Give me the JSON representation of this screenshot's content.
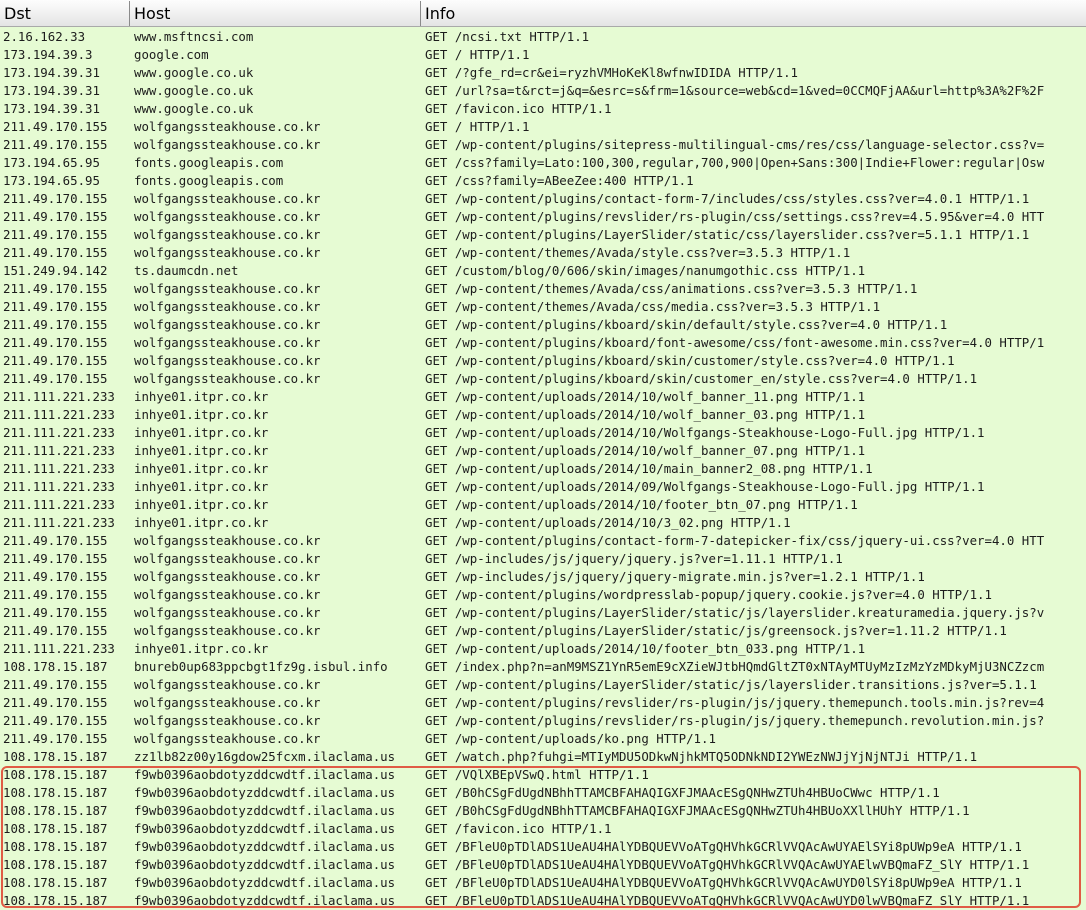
{
  "columns": {
    "dst": "Dst",
    "host": "Host",
    "info": "Info"
  },
  "colors": {
    "row_bg": "#e6fbd3",
    "highlight_border": "#e05b45"
  },
  "rows": [
    [
      "2.16.162.33",
      "www.msftncsi.com",
      "GET /ncsi.txt HTTP/1.1"
    ],
    [
      "173.194.39.3",
      "google.com",
      "GET / HTTP/1.1"
    ],
    [
      "173.194.39.31",
      "www.google.co.uk",
      "GET /?gfe_rd=cr&ei=ryzhVMHoKeKl8wfnwIDIDA HTTP/1.1"
    ],
    [
      "173.194.39.31",
      "www.google.co.uk",
      "GET /url?sa=t&rct=j&q=&esrc=s&frm=1&source=web&cd=1&ved=0CCMQFjAA&url=http%3A%2F%2F"
    ],
    [
      "173.194.39.31",
      "www.google.co.uk",
      "GET /favicon.ico HTTP/1.1"
    ],
    [
      "211.49.170.155",
      "wolfgangssteakhouse.co.kr",
      "GET / HTTP/1.1"
    ],
    [
      "211.49.170.155",
      "wolfgangssteakhouse.co.kr",
      "GET /wp-content/plugins/sitepress-multilingual-cms/res/css/language-selector.css?v="
    ],
    [
      "173.194.65.95",
      "fonts.googleapis.com",
      "GET /css?family=Lato:100,300,regular,700,900|Open+Sans:300|Indie+Flower:regular|Osw"
    ],
    [
      "173.194.65.95",
      "fonts.googleapis.com",
      "GET /css?family=ABeeZee:400 HTTP/1.1"
    ],
    [
      "211.49.170.155",
      "wolfgangssteakhouse.co.kr",
      "GET /wp-content/plugins/contact-form-7/includes/css/styles.css?ver=4.0.1 HTTP/1.1"
    ],
    [
      "211.49.170.155",
      "wolfgangssteakhouse.co.kr",
      "GET /wp-content/plugins/revslider/rs-plugin/css/settings.css?rev=4.5.95&ver=4.0 HTT"
    ],
    [
      "211.49.170.155",
      "wolfgangssteakhouse.co.kr",
      "GET /wp-content/plugins/LayerSlider/static/css/layerslider.css?ver=5.1.1 HTTP/1.1"
    ],
    [
      "211.49.170.155",
      "wolfgangssteakhouse.co.kr",
      "GET /wp-content/themes/Avada/style.css?ver=3.5.3 HTTP/1.1"
    ],
    [
      "151.249.94.142",
      "ts.daumcdn.net",
      "GET /custom/blog/0/606/skin/images/nanumgothic.css HTTP/1.1"
    ],
    [
      "211.49.170.155",
      "wolfgangssteakhouse.co.kr",
      "GET /wp-content/themes/Avada/css/animations.css?ver=3.5.3 HTTP/1.1"
    ],
    [
      "211.49.170.155",
      "wolfgangssteakhouse.co.kr",
      "GET /wp-content/themes/Avada/css/media.css?ver=3.5.3 HTTP/1.1"
    ],
    [
      "211.49.170.155",
      "wolfgangssteakhouse.co.kr",
      "GET /wp-content/plugins/kboard/skin/default/style.css?ver=4.0 HTTP/1.1"
    ],
    [
      "211.49.170.155",
      "wolfgangssteakhouse.co.kr",
      "GET /wp-content/plugins/kboard/font-awesome/css/font-awesome.min.css?ver=4.0 HTTP/1"
    ],
    [
      "211.49.170.155",
      "wolfgangssteakhouse.co.kr",
      "GET /wp-content/plugins/kboard/skin/customer/style.css?ver=4.0 HTTP/1.1"
    ],
    [
      "211.49.170.155",
      "wolfgangssteakhouse.co.kr",
      "GET /wp-content/plugins/kboard/skin/customer_en/style.css?ver=4.0 HTTP/1.1"
    ],
    [
      "211.111.221.233",
      "inhye01.itpr.co.kr",
      "GET /wp-content/uploads/2014/10/wolf_banner_11.png HTTP/1.1"
    ],
    [
      "211.111.221.233",
      "inhye01.itpr.co.kr",
      "GET /wp-content/uploads/2014/10/wolf_banner_03.png HTTP/1.1"
    ],
    [
      "211.111.221.233",
      "inhye01.itpr.co.kr",
      "GET /wp-content/uploads/2014/10/Wolfgangs-Steakhouse-Logo-Full.jpg HTTP/1.1"
    ],
    [
      "211.111.221.233",
      "inhye01.itpr.co.kr",
      "GET /wp-content/uploads/2014/10/wolf_banner_07.png HTTP/1.1"
    ],
    [
      "211.111.221.233",
      "inhye01.itpr.co.kr",
      "GET /wp-content/uploads/2014/10/main_banner2_08.png HTTP/1.1"
    ],
    [
      "211.111.221.233",
      "inhye01.itpr.co.kr",
      "GET /wp-content/uploads/2014/09/Wolfgangs-Steakhouse-Logo-Full.jpg HTTP/1.1"
    ],
    [
      "211.111.221.233",
      "inhye01.itpr.co.kr",
      "GET /wp-content/uploads/2014/10/footer_btn_07.png HTTP/1.1"
    ],
    [
      "211.111.221.233",
      "inhye01.itpr.co.kr",
      "GET /wp-content/uploads/2014/10/3_02.png HTTP/1.1"
    ],
    [
      "211.49.170.155",
      "wolfgangssteakhouse.co.kr",
      "GET /wp-content/plugins/contact-form-7-datepicker-fix/css/jquery-ui.css?ver=4.0 HTT"
    ],
    [
      "211.49.170.155",
      "wolfgangssteakhouse.co.kr",
      "GET /wp-includes/js/jquery/jquery.js?ver=1.11.1 HTTP/1.1"
    ],
    [
      "211.49.170.155",
      "wolfgangssteakhouse.co.kr",
      "GET /wp-includes/js/jquery/jquery-migrate.min.js?ver=1.2.1 HTTP/1.1"
    ],
    [
      "211.49.170.155",
      "wolfgangssteakhouse.co.kr",
      "GET /wp-content/plugins/wordpresslab-popup/jquery.cookie.js?ver=4.0 HTTP/1.1"
    ],
    [
      "211.49.170.155",
      "wolfgangssteakhouse.co.kr",
      "GET /wp-content/plugins/LayerSlider/static/js/layerslider.kreaturamedia.jquery.js?v"
    ],
    [
      "211.49.170.155",
      "wolfgangssteakhouse.co.kr",
      "GET /wp-content/plugins/LayerSlider/static/js/greensock.js?ver=1.11.2 HTTP/1.1"
    ],
    [
      "211.111.221.233",
      "inhye01.itpr.co.kr",
      "GET /wp-content/uploads/2014/10/footer_btn_033.png HTTP/1.1"
    ],
    [
      "108.178.15.187",
      "bnureb0up683ppcbgt1fz9g.isbul.info",
      "GET /index.php?n=anM9MSZ1YnR5emE9cXZieWJtbHQmdGltZT0xNTAyMTUyMzIzMzYzMDkyMjU3NCZzcm"
    ],
    [
      "211.49.170.155",
      "wolfgangssteakhouse.co.kr",
      "GET /wp-content/plugins/LayerSlider/static/js/layerslider.transitions.js?ver=5.1.1"
    ],
    [
      "211.49.170.155",
      "wolfgangssteakhouse.co.kr",
      "GET /wp-content/plugins/revslider/rs-plugin/js/jquery.themepunch.tools.min.js?rev=4"
    ],
    [
      "211.49.170.155",
      "wolfgangssteakhouse.co.kr",
      "GET /wp-content/plugins/revslider/rs-plugin/js/jquery.themepunch.revolution.min.js?"
    ],
    [
      "211.49.170.155",
      "wolfgangssteakhouse.co.kr",
      "GET /wp-content/uploads/ko.png HTTP/1.1"
    ],
    [
      "108.178.15.187",
      "zz1lb82z00y16gdow25fcxm.ilaclama.us",
      "GET /watch.php?fuhgi=MTIyMDU5ODkwNjhkMTQ5ODNkNDI2YWEzNWJjYjNjNTJi HTTP/1.1"
    ],
    [
      "108.178.15.187",
      "f9wb0396aobdotyzddcwdtf.ilaclama.us",
      "GET /VQlXBEpVSwQ.html HTTP/1.1"
    ],
    [
      "108.178.15.187",
      "f9wb0396aobdotyzddcwdtf.ilaclama.us",
      "GET /B0hCSgFdUgdNBhhTTAMCBFAHAQIGXFJMAAcESgQNHwZTUh4HBUoCWwc HTTP/1.1"
    ],
    [
      "108.178.15.187",
      "f9wb0396aobdotyzddcwdtf.ilaclama.us",
      "GET /B0hCSgFdUgdNBhhTTAMCBFAHAQIGXFJMAAcESgQNHwZTUh4HBUoXXllHUhY HTTP/1.1"
    ],
    [
      "108.178.15.187",
      "f9wb0396aobdotyzddcwdtf.ilaclama.us",
      "GET /favicon.ico HTTP/1.1"
    ],
    [
      "108.178.15.187",
      "f9wb0396aobdotyzddcwdtf.ilaclama.us",
      "GET /BFleU0pTDlADS1UeAU4HAlYDBQUEVVoATgQHVhkGCRlVVQAcAwUYAElSYi8pUWp9eA HTTP/1.1"
    ],
    [
      "108.178.15.187",
      "f9wb0396aobdotyzddcwdtf.ilaclama.us",
      "GET /BFleU0pTDlADS1UeAU4HAlYDBQUEVVoATgQHVhkGCRlVVQAcAwUYAElwVBQmaFZ_SlY HTTP/1.1"
    ],
    [
      "108.178.15.187",
      "f9wb0396aobdotyzddcwdtf.ilaclama.us",
      "GET /BFleU0pTDlADS1UeAU4HAlYDBQUEVVoATgQHVhkGCRlVVQAcAwUYD0lSYi8pUWp9eA HTTP/1.1"
    ],
    [
      "108.178.15.187",
      "f9wb0396aobdotyzddcwdtf.ilaclama.us",
      "GET /BFleU0pTDlADS1UeAU4HAlYDBQUEVVoATgQHVhkGCRlVVQAcAwUYD0lwVBQmaFZ_SlY HTTP/1.1"
    ]
  ]
}
